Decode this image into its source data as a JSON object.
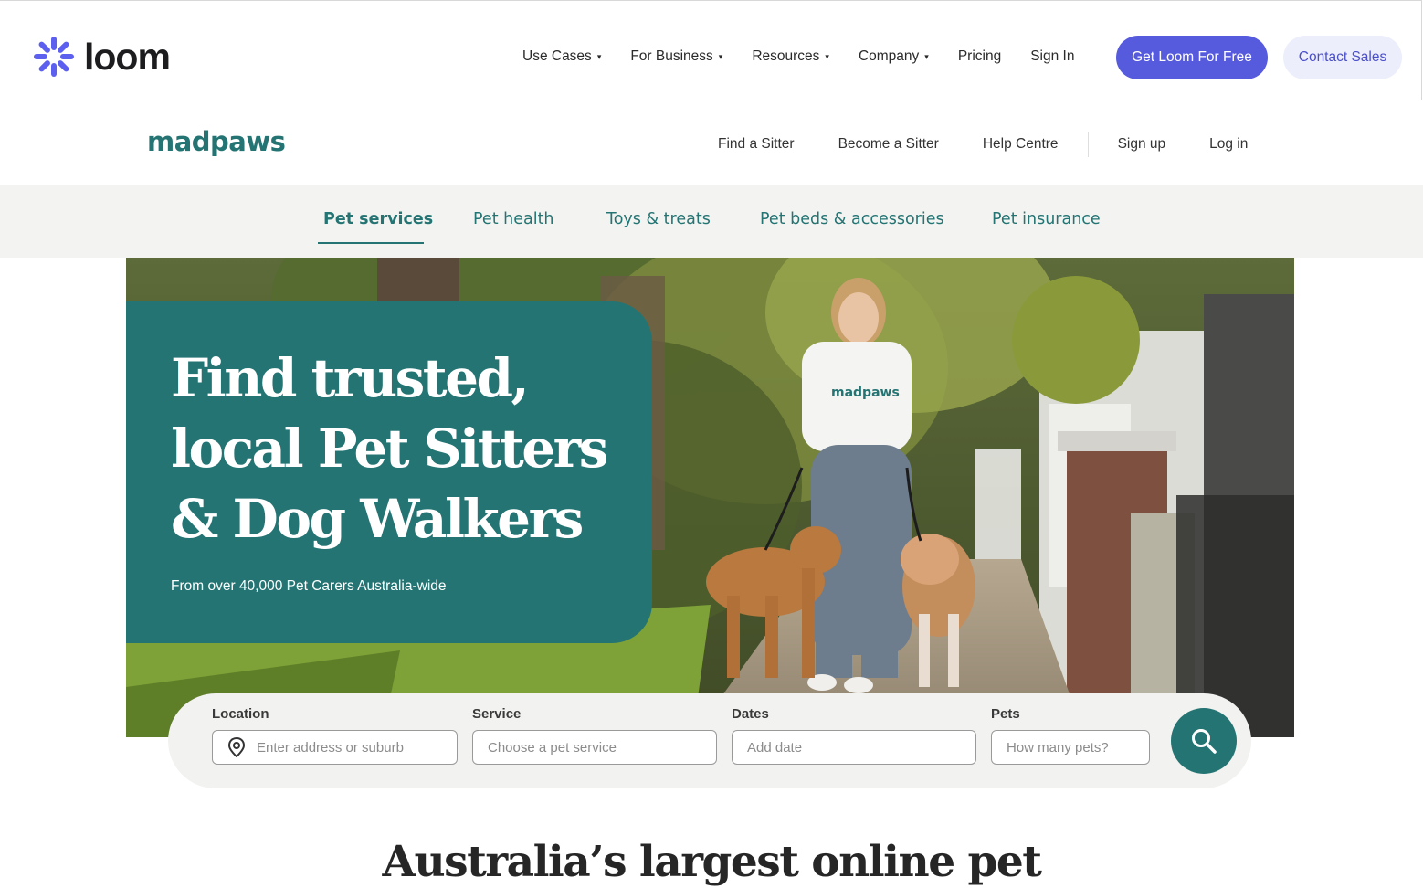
{
  "loom": {
    "brand": "loom",
    "nav": [
      {
        "label": "Use Cases",
        "caret": "▾"
      },
      {
        "label": "For Business",
        "caret": "▾"
      },
      {
        "label": "Resources",
        "caret": "▾"
      },
      {
        "label": "Company",
        "caret": "▾"
      },
      {
        "label": "Pricing"
      },
      {
        "label": "Sign In"
      }
    ],
    "cta_primary": "Get Loom For Free",
    "cta_secondary": "Contact Sales",
    "accent_color": "#565add"
  },
  "madpaws": {
    "logo": "madpaws",
    "nav": [
      "Find a Sitter",
      "Become a Sitter",
      "Help Centre"
    ],
    "account": [
      "Sign up",
      "Log in"
    ],
    "brand_color": "#237473"
  },
  "categories": {
    "tabs": [
      "Pet services",
      "Pet health",
      "Toys & treats",
      "Pet beds & accessories",
      "Pet insurance"
    ],
    "active": "Pet services"
  },
  "hero": {
    "title_lines": [
      "Find trusted,",
      "local Pet Sitters",
      "& Dog Walkers"
    ],
    "subtitle": "From over 40,000 Pet Carers Australia-wide",
    "shirt_logo": "madpaws"
  },
  "search": {
    "location": {
      "label": "Location",
      "placeholder": "Enter address or suburb",
      "icon": "location-pin-icon"
    },
    "service": {
      "label": "Service",
      "placeholder": "Choose a pet service"
    },
    "dates": {
      "label": "Dates",
      "placeholder": "Add date"
    },
    "pets": {
      "label": "Pets",
      "placeholder": "How many pets?"
    },
    "button_icon": "search-icon"
  },
  "section": {
    "heading": "Australia’s largest online pet"
  }
}
